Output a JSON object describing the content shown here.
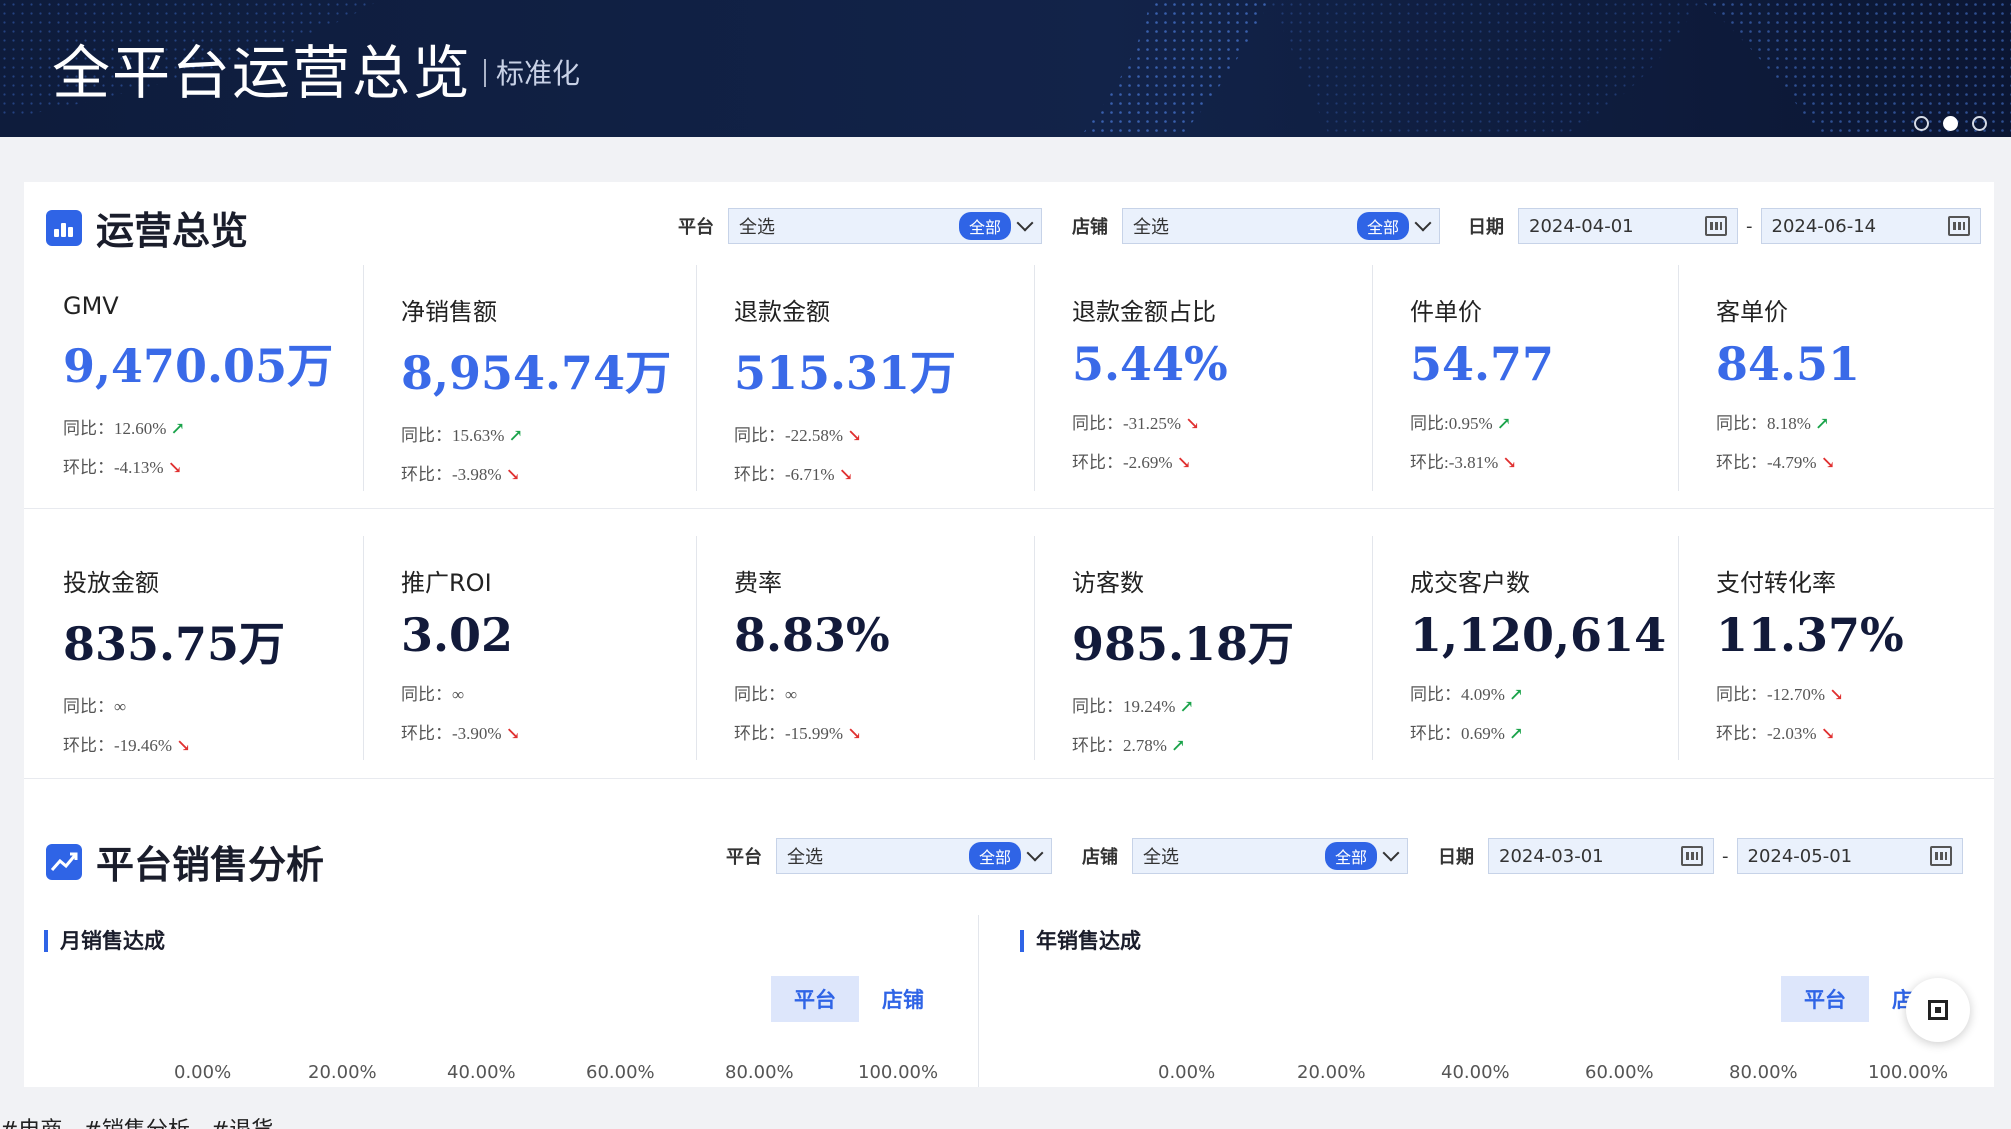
{
  "banner": {
    "title": "全平台运营总览",
    "subtitle": "标准化"
  },
  "overview": {
    "title": "运营总览",
    "filters": {
      "platform_label": "平台",
      "platform_value": "全选",
      "platform_tag": "全部",
      "store_label": "店铺",
      "store_value": "全选",
      "store_tag": "全部",
      "date_label": "日期",
      "date_start": "2024-04-01",
      "date_end": "2024-06-14"
    },
    "kpis": [
      {
        "label": "GMV",
        "value": "9,470.05万",
        "yoy": "同比：12.60%",
        "yoy_dir": "↗",
        "mom": "环比：-4.13%",
        "mom_dir": "↘"
      },
      {
        "label": "净销售额",
        "value": "8,954.74万",
        "yoy": "同比：15.63%",
        "yoy_dir": "↗",
        "mom": "环比：-3.98%",
        "mom_dir": "↘"
      },
      {
        "label": "退款金额",
        "value": "515.31万",
        "yoy": "同比：-22.58%",
        "yoy_dir": "↘",
        "mom": "环比：-6.71%",
        "mom_dir": "↘"
      },
      {
        "label": "退款金额占比",
        "value": "5.44%",
        "yoy": "同比：-31.25%",
        "yoy_dir": "↘",
        "mom": "环比：-2.69%",
        "mom_dir": "↘"
      },
      {
        "label": "件单价",
        "value": "54.77",
        "yoy": "同比:0.95%",
        "yoy_dir": "↗",
        "mom": "环比:-3.81%",
        "mom_dir": "↘"
      },
      {
        "label": "客单价",
        "value": "84.51",
        "yoy": "同比：8.18%",
        "yoy_dir": "↗",
        "mom": "环比：-4.79%",
        "mom_dir": "↘"
      },
      {
        "label": "投放金额",
        "value": "835.75万",
        "yoy": "同比：∞",
        "yoy_dir": "",
        "mom": "环比：-19.46%",
        "mom_dir": "↘"
      },
      {
        "label": "推广ROI",
        "value": "3.02",
        "yoy": "同比：∞",
        "yoy_dir": "",
        "mom": "环比：-3.90%",
        "mom_dir": "↘"
      },
      {
        "label": "费率",
        "value": "8.83%",
        "yoy": "同比：∞",
        "yoy_dir": "",
        "mom": "环比：-15.99%",
        "mom_dir": "↘"
      },
      {
        "label": "访客数",
        "value": "985.18万",
        "yoy": "同比：19.24%",
        "yoy_dir": "↗",
        "mom": "环比：2.78%",
        "mom_dir": "↗"
      },
      {
        "label": "成交客户数",
        "value": "1,120,614",
        "yoy": "同比：4.09%",
        "yoy_dir": "↗",
        "mom": "环比：0.69%",
        "mom_dir": "↗"
      },
      {
        "label": "支付转化率",
        "value": "11.37%",
        "yoy": "同比：-12.70%",
        "yoy_dir": "↘",
        "mom": "环比：-2.03%",
        "mom_dir": "↘"
      }
    ]
  },
  "sales": {
    "title": "平台销售分析",
    "filters": {
      "platform_label": "平台",
      "platform_value": "全选",
      "platform_tag": "全部",
      "store_label": "店铺",
      "store_value": "全选",
      "store_tag": "全部",
      "date_label": "日期",
      "date_start": "2024-03-01",
      "date_end": "2024-05-01"
    },
    "monthly": {
      "title": "月销售达成",
      "toggle": [
        "平台",
        "店铺"
      ],
      "ticks": [
        "0.00%",
        "20.00%",
        "40.00%",
        "60.00%",
        "80.00%",
        "100.00%"
      ]
    },
    "yearly": {
      "title": "年销售达成",
      "toggle": [
        "平台",
        "店铺"
      ],
      "ticks": [
        "0.00%",
        "20.00%",
        "40.00%",
        "60.00%",
        "80.00%",
        "100.00%"
      ]
    }
  },
  "hashtags": [
    "#电商",
    "#销售分析",
    "#退货"
  ],
  "colors": {
    "accent": "#2f64e6",
    "up": "#1aa34a",
    "down": "#e03030",
    "banner": "#0e1c3c"
  }
}
